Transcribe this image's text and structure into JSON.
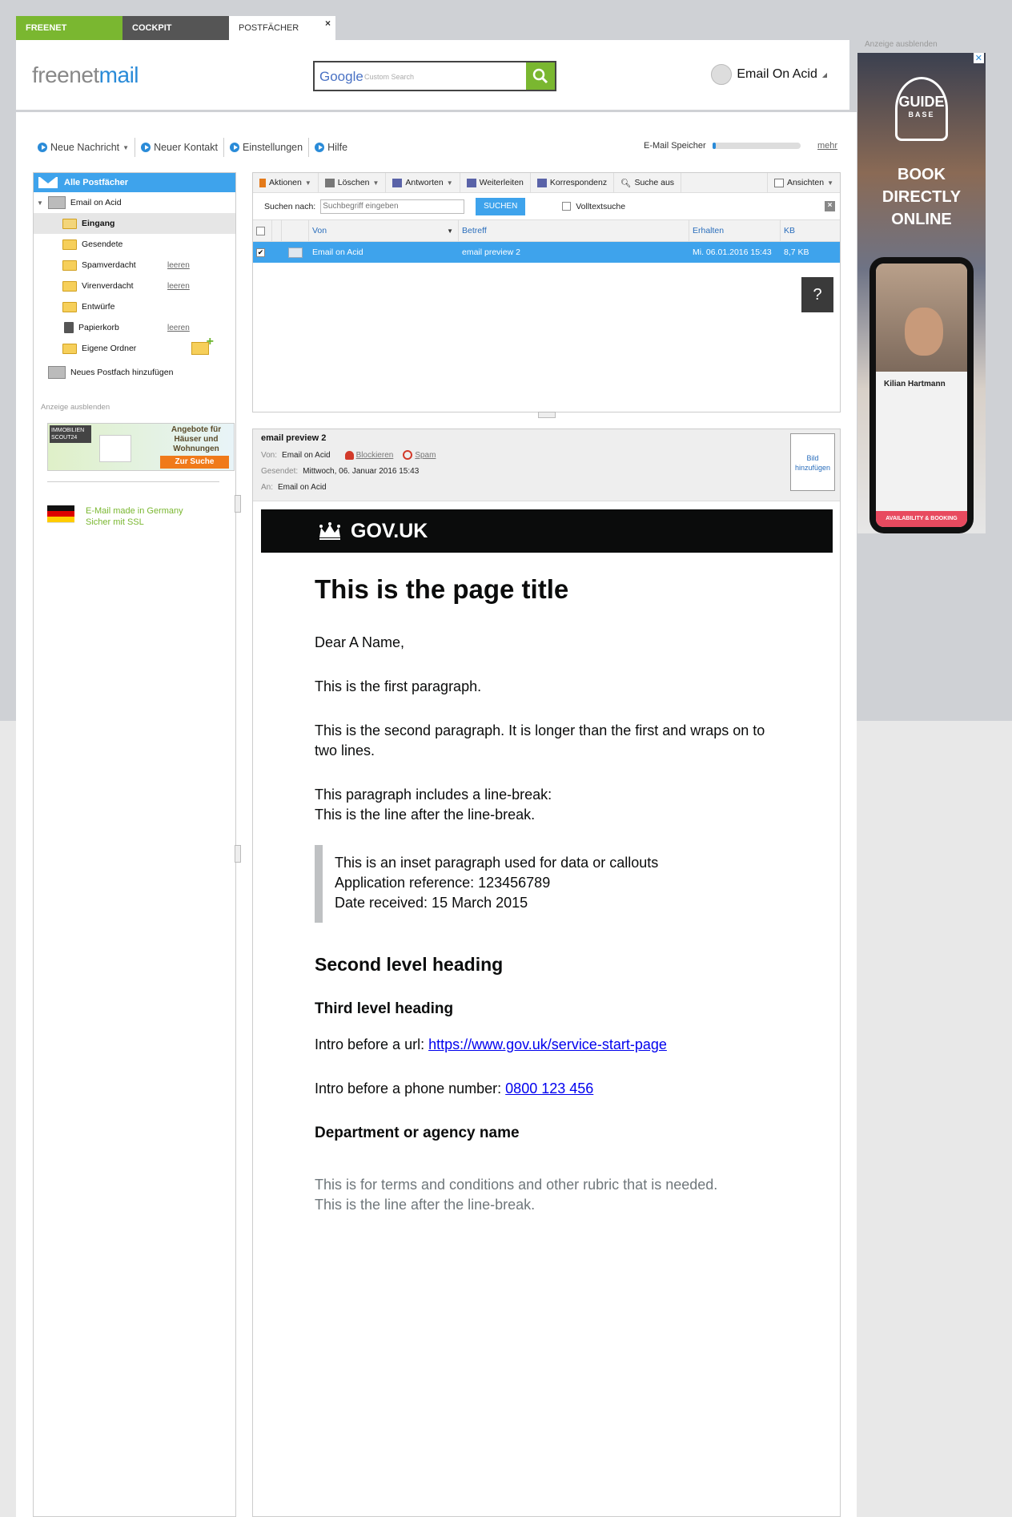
{
  "tabs": [
    {
      "label": "FREENET"
    },
    {
      "label": "COCKPIT"
    },
    {
      "label": "POSTFÄCHER",
      "close": "×"
    }
  ],
  "header": {
    "logo_part1": "freenet",
    "logo_part2": "mail",
    "search_brand": "Google",
    "search_placeholder": "Custom Search",
    "user_name": "Email On Acid"
  },
  "ad_right": {
    "hide_label": "Anzeige ausblenden",
    "brand_top": "GUIDE",
    "brand_bottom": "BASE",
    "headline": "BOOK DIRECTLY ONLINE",
    "profile_name": "Kilian Hartmann",
    "cta": "AVAILABILITY & BOOKING",
    "close": "✕"
  },
  "toolbar": {
    "new_message": "Neue Nachricht",
    "new_contact": "Neuer Kontakt",
    "settings": "Einstellungen",
    "help": "Hilfe",
    "storage_label": "E-Mail Speicher",
    "storage_fraction": 0.04,
    "more": "mehr"
  },
  "sidebar": {
    "header": "Alle Postfächer",
    "account": "Email on Acid",
    "folders": [
      {
        "label": "Eingang",
        "action": ""
      },
      {
        "label": "Gesendete",
        "action": ""
      },
      {
        "label": "Spamverdacht",
        "action": "leeren"
      },
      {
        "label": "Virenverdacht",
        "action": "leeren"
      },
      {
        "label": "Entwürfe",
        "action": ""
      },
      {
        "label": "Papierkorb",
        "action": "leeren"
      },
      {
        "label": "Eigene Ordner",
        "action": ""
      }
    ],
    "add_mailbox": "Neues Postfach hinzufügen",
    "ad_hide": "Anzeige ausblenden",
    "ad_brand": "IMMOBILIEN SCOUT24",
    "ad_text": "Angebote für Häuser und Wohnungen",
    "ad_cta": "Zur Suche",
    "germany_line1": "E-Mail made in Germany",
    "germany_line2": "Sicher mit SSL"
  },
  "list_toolbar": {
    "actions": "Aktionen",
    "delete": "Löschen",
    "reply": "Antworten",
    "forward": "Weiterleiten",
    "correspondence": "Korrespondenz",
    "search_off": "Suche aus",
    "views": "Ansichten"
  },
  "search": {
    "label": "Suchen nach:",
    "placeholder": "Suchbegriff eingeben",
    "button": "SUCHEN",
    "fulltext": "Volltextsuche",
    "close": "×"
  },
  "columns": {
    "from": "Von",
    "subject": "Betreff",
    "received": "Erhalten",
    "size": "KB"
  },
  "messages": [
    {
      "from": "Email on Acid",
      "subject": "email preview 2",
      "received": "Mi. 06.01.2016 15:43",
      "size": "8,7 KB",
      "checked": true
    }
  ],
  "help_button": "?",
  "reader": {
    "subject": "email preview 2",
    "from_label": "Von:",
    "from": "Email on Acid",
    "block": "Blockieren",
    "spam": "Spam",
    "sent_label": "Gesendet:",
    "sent": "Mittwoch, 06. Januar 2016 15:43",
    "to_label": "An:",
    "to": "Email on Acid",
    "add_picture": "Bild hinzufügen"
  },
  "email": {
    "gov_brand": "GOV.UK",
    "title": "This is the page title",
    "salutation": "Dear A Name,",
    "p1": "This is the first paragraph.",
    "p2": "This is the second paragraph. It is longer than the first and wraps on to two lines.",
    "p3_line1": "This paragraph includes a line-break:",
    "p3_line2": "This is the line after the line-break.",
    "inset_line1": "This is an inset paragraph used for data or callouts",
    "inset_line2": "Application reference: 123456789",
    "inset_line3": "Date received: 15 March 2015",
    "h2": "Second level heading",
    "h3": "Third level heading",
    "url_intro": "Intro before a url: ",
    "url": "https://www.gov.uk/service-start-page",
    "phone_intro": "Intro before a phone number: ",
    "phone": "0800 123 456",
    "dept": "Department or agency name",
    "rubric_line1": "This is for terms and conditions and other rubric that is needed.",
    "rubric_line2": "This is the line after the line-break."
  }
}
